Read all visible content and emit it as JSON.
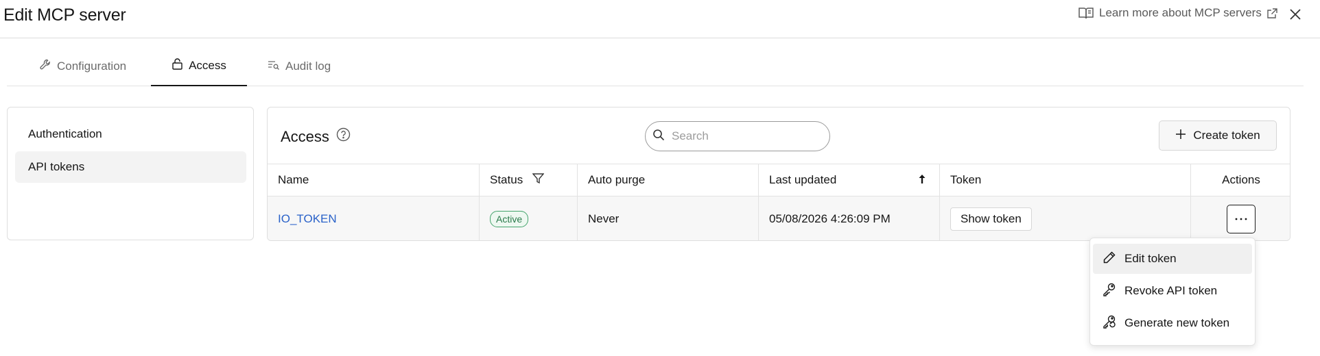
{
  "header": {
    "title": "Edit MCP server",
    "learn_more": "Learn more about MCP servers",
    "close_icon": "close-icon"
  },
  "tabs": [
    {
      "label": "Configuration",
      "icon": "wrench-icon",
      "active": false
    },
    {
      "label": "Access",
      "icon": "lock-icon",
      "active": true
    },
    {
      "label": "Audit log",
      "icon": "list-search-icon",
      "active": false
    }
  ],
  "sidebar": {
    "items": [
      {
        "label": "Authentication",
        "selected": false
      },
      {
        "label": "API tokens",
        "selected": true
      }
    ]
  },
  "access": {
    "title": "Access",
    "search_placeholder": "Search",
    "create_label": "Create token"
  },
  "table": {
    "columns": [
      "Name",
      "Status",
      "Auto purge",
      "Last updated",
      "Token",
      "Actions"
    ],
    "sort_column": "Last updated",
    "sort_direction": "ascending",
    "rows": [
      {
        "name": "IO_TOKEN",
        "status": "Active",
        "auto_purge": "Never",
        "last_updated": "05/08/2026 4:26:09 PM",
        "token_button": "Show token"
      }
    ]
  },
  "menu": {
    "items": [
      {
        "label": "Edit token",
        "icon": "pencil-icon",
        "highlighted": true
      },
      {
        "label": "Revoke API token",
        "icon": "key-icon",
        "highlighted": false
      },
      {
        "label": "Generate new token",
        "icon": "key-refresh-icon",
        "highlighted": false
      }
    ]
  },
  "colors": {
    "link": "#2a62c9",
    "status_active_border": "#43a36b",
    "status_active_text": "#2a7a4b",
    "tab_active_underline": "#161616"
  }
}
